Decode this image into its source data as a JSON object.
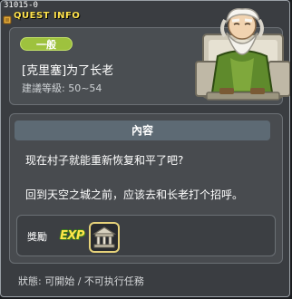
{
  "window": {
    "quest_id": "31015-0",
    "title": "QUEST INFO"
  },
  "quest": {
    "category": "一般",
    "name": "[克里塞]为了长老",
    "level_label": "建議等級: 50~54"
  },
  "content": {
    "header": "內容",
    "lines": [
      "现在村子就能重新恢复和平了吧?",
      "回到天空之城之前，应该去和长老打个招呼。"
    ]
  },
  "reward": {
    "label": "獎勵",
    "exp_label": "EXP",
    "item_icon": "temple-icon"
  },
  "status": "狀態: 可開始 / 不可执行任務",
  "colors": {
    "title": "#ffe34d",
    "category_pill": "#9ec23e",
    "header_bar": "#5d6a74",
    "exp": "#ffe54a"
  },
  "npc": {
    "icon": "elder-npc-icon"
  }
}
